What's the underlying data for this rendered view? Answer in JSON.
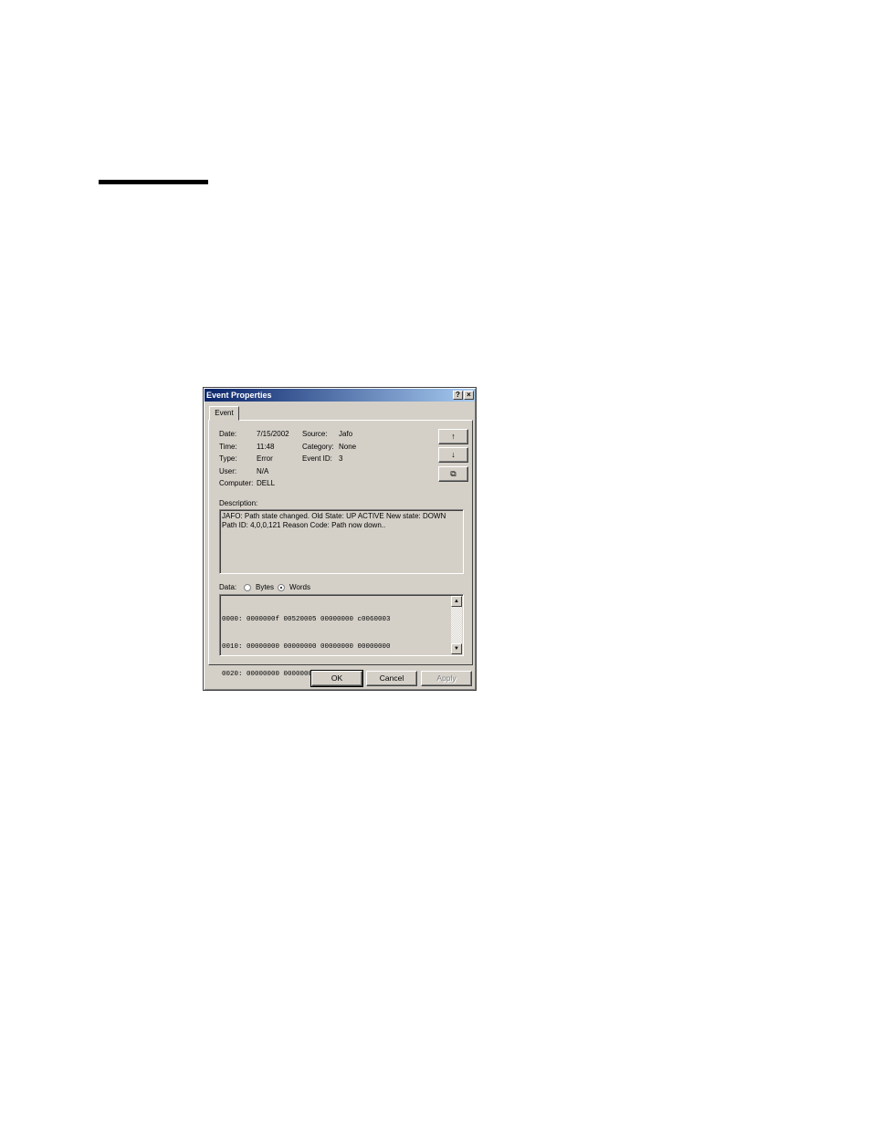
{
  "dialog": {
    "title": "Event Properties",
    "help_glyph": "?",
    "close_glyph": "×",
    "tab_label": "Event"
  },
  "fields": {
    "date_label": "Date:",
    "date_value": "7/15/2002",
    "time_label": "Time:",
    "time_value": "11:48",
    "type_label": "Type:",
    "type_value": "Error",
    "user_label": "User:",
    "user_value": "N/A",
    "computer_label": "Computer:",
    "computer_value": "DELL",
    "source_label": "Source:",
    "source_value": "Jafo",
    "category_label": "Category:",
    "category_value": "None",
    "eventid_label": "Event ID:",
    "eventid_value": "3"
  },
  "side_buttons": {
    "up": "↑",
    "down": "↓",
    "copy": "⧉"
  },
  "description": {
    "label": "Description:",
    "lines": [
      "JAFO: Path state changed.  Old State: UP ACTIVE  New state: DOWN",
      "Path ID: 4,0,0,121  Reason Code: Path now down.."
    ]
  },
  "data": {
    "label": "Data:",
    "bytes_label": "Bytes",
    "words_label": "Words",
    "selected": "words",
    "hex_lines": [
      "0000: 0000000f 00520005 00000000 c0060003",
      "0010: 00000000 00000000 00000000 00000000",
      "0020: 00000000 00000000"
    ]
  },
  "buttons": {
    "ok": "OK",
    "cancel": "Cancel",
    "apply": "Apply"
  }
}
